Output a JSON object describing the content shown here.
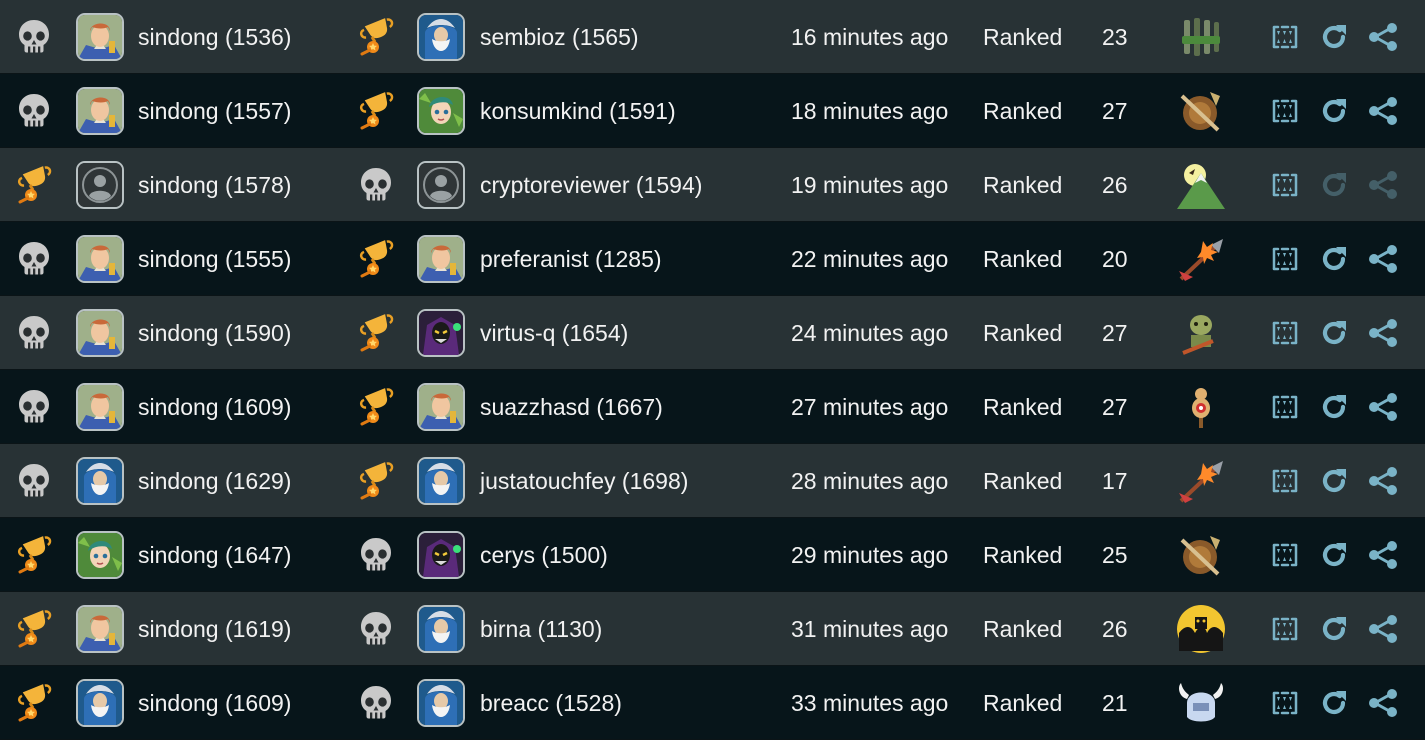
{
  "colors": {
    "accent": "#7ab3c7",
    "text": "#f2f2f2",
    "row_light": "#283235",
    "row_dark": "#07151a",
    "trophy": "#f0a424",
    "skull": "#c8c8c8"
  },
  "actions": [
    "watch-replay-icon",
    "rematch-icon",
    "share-icon"
  ],
  "games": [
    {
      "player1": {
        "result": "loss",
        "avatar": "noble-avatar",
        "name": "sindong (1536)"
      },
      "player2": {
        "result": "win",
        "avatar": "wizard-avatar",
        "name": "sembioz (1565)"
      },
      "time": "16 minutes ago",
      "type": "Ranked",
      "turns": "23",
      "deck": "potions-deck-icon",
      "actions_enabled": true
    },
    {
      "player1": {
        "result": "loss",
        "avatar": "noble-avatar",
        "name": "sindong (1557)"
      },
      "player2": {
        "result": "win",
        "avatar": "elf-avatar",
        "name": "konsumkind (1591)"
      },
      "time": "18 minutes ago",
      "type": "Ranked",
      "turns": "27",
      "deck": "shield-deck-icon",
      "actions_enabled": true
    },
    {
      "player1": {
        "result": "win",
        "avatar": "default-avatar",
        "name": "sindong (1578)"
      },
      "player2": {
        "result": "loss",
        "avatar": "default-avatar",
        "name": "cryptoreviewer (1594)"
      },
      "time": "19 minutes ago",
      "type": "Ranked",
      "turns": "26",
      "deck": "mountain-deck-icon",
      "actions_enabled": false
    },
    {
      "player1": {
        "result": "loss",
        "avatar": "noble-avatar",
        "name": "sindong (1555)"
      },
      "player2": {
        "result": "win",
        "avatar": "noble-avatar",
        "name": "preferanist (1285)"
      },
      "time": "22 minutes ago",
      "type": "Ranked",
      "turns": "20",
      "deck": "arrow-deck-icon",
      "actions_enabled": true
    },
    {
      "player1": {
        "result": "loss",
        "avatar": "noble-avatar",
        "name": "sindong (1590)"
      },
      "player2": {
        "result": "win",
        "avatar": "demon-avatar",
        "name": "virtus-q (1654)"
      },
      "time": "24 minutes ago",
      "type": "Ranked",
      "turns": "27",
      "deck": "goblin-deck-icon",
      "actions_enabled": true
    },
    {
      "player1": {
        "result": "loss",
        "avatar": "noble-avatar",
        "name": "sindong (1609)"
      },
      "player2": {
        "result": "win",
        "avatar": "noble-avatar",
        "name": "suazzhasd (1667)"
      },
      "time": "27 minutes ago",
      "type": "Ranked",
      "turns": "27",
      "deck": "target-dummy-deck-icon",
      "actions_enabled": true
    },
    {
      "player1": {
        "result": "loss",
        "avatar": "wizard-avatar",
        "name": "sindong (1629)"
      },
      "player2": {
        "result": "win",
        "avatar": "wizard-avatar",
        "name": "justatouchfey (1698)"
      },
      "time": "28 minutes ago",
      "type": "Ranked",
      "turns": "17",
      "deck": "arrow-deck-icon",
      "actions_enabled": true
    },
    {
      "player1": {
        "result": "win",
        "avatar": "elf-avatar",
        "name": "sindong (1647)"
      },
      "player2": {
        "result": "loss",
        "avatar": "demon-avatar",
        "name": "cerys (1500)"
      },
      "time": "29 minutes ago",
      "type": "Ranked",
      "turns": "25",
      "deck": "shield-deck-icon",
      "actions_enabled": true
    },
    {
      "player1": {
        "result": "win",
        "avatar": "noble-avatar",
        "name": "sindong (1619)"
      },
      "player2": {
        "result": "loss",
        "avatar": "wizard-avatar",
        "name": "birna (1130)"
      },
      "time": "31 minutes ago",
      "type": "Ranked",
      "turns": "26",
      "deck": "shadow-deck-icon",
      "actions_enabled": true
    },
    {
      "player1": {
        "result": "win",
        "avatar": "wizard-avatar",
        "name": "sindong (1609)"
      },
      "player2": {
        "result": "loss",
        "avatar": "wizard-avatar",
        "name": "breacc (1528)"
      },
      "time": "33 minutes ago",
      "type": "Ranked",
      "turns": "21",
      "deck": "viking-helmet-deck-icon",
      "actions_enabled": true
    }
  ]
}
